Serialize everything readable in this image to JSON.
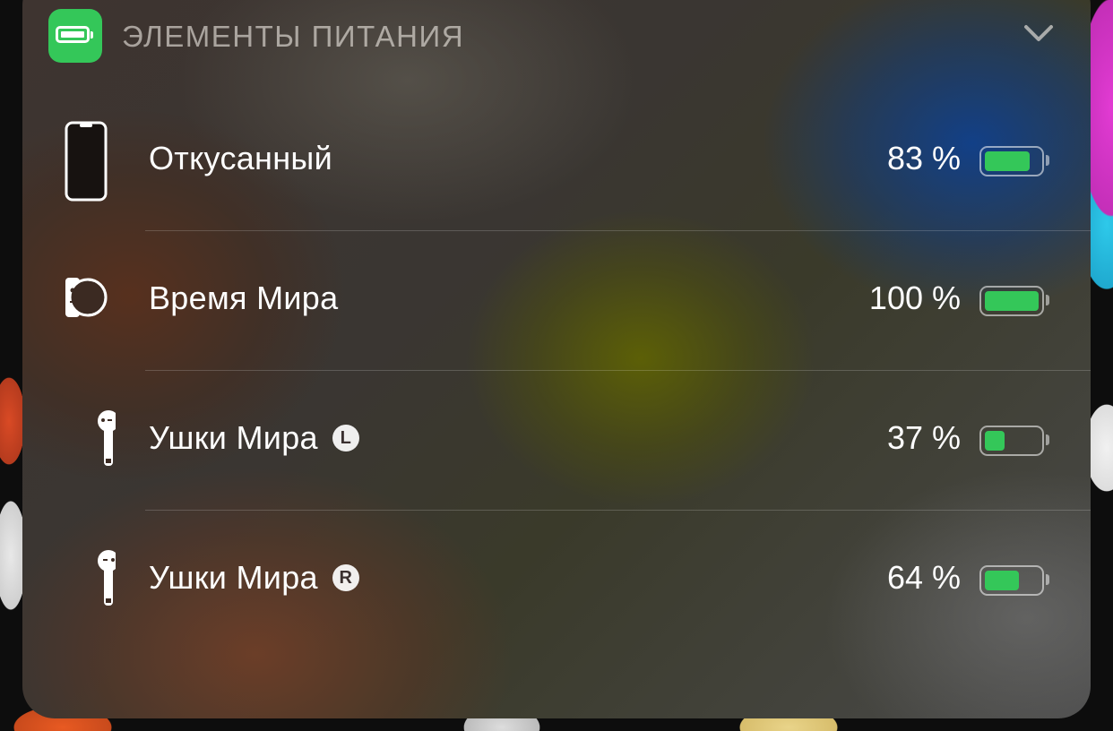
{
  "widget": {
    "title": "ЭЛЕМЕНТЫ ПИТАНИЯ",
    "app_icon": "battery-icon",
    "collapse_icon": "chevron-down-icon",
    "accent_color": "#34c759"
  },
  "devices": [
    {
      "name": "Откусанный",
      "side": "",
      "percent_label": "83 %",
      "level": 0.83,
      "icon": "iphone-icon"
    },
    {
      "name": "Время Мира",
      "side": "",
      "percent_label": "100 %",
      "level": 1.0,
      "icon": "watch-icon"
    },
    {
      "name": "Ушки Мира",
      "side": "L",
      "percent_label": "37 %",
      "level": 0.37,
      "icon": "airpod-left-icon"
    },
    {
      "name": "Ушки Мира",
      "side": "R",
      "percent_label": "64 %",
      "level": 0.64,
      "icon": "airpod-right-icon"
    }
  ]
}
